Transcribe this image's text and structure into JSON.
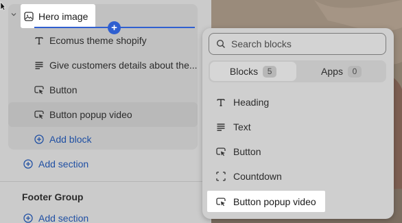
{
  "sidebar": {
    "section": {
      "title": "Hero image",
      "blocks": [
        {
          "label": "Ecomus theme shopify",
          "icon": "text-icon"
        },
        {
          "label": "Give customers details about the...",
          "icon": "paragraph-icon"
        },
        {
          "label": "Button",
          "icon": "button-cursor-icon"
        },
        {
          "label": "Button popup video",
          "icon": "button-cursor-icon"
        }
      ],
      "add_block": "Add block"
    },
    "add_section": "Add section",
    "footer_group": {
      "title": "Footer Group",
      "add_section": "Add section"
    }
  },
  "popover": {
    "search_placeholder": "Search blocks",
    "tabs": [
      {
        "label": "Blocks",
        "count": "5"
      },
      {
        "label": "Apps",
        "count": "0"
      }
    ],
    "blocks": [
      {
        "label": "Heading",
        "icon": "text-icon"
      },
      {
        "label": "Text",
        "icon": "paragraph-icon"
      },
      {
        "label": "Button",
        "icon": "button-cursor-icon"
      },
      {
        "label": "Countdown",
        "icon": "countdown-frame-icon"
      },
      {
        "label": "Button popup video",
        "icon": "button-cursor-icon"
      }
    ]
  },
  "colors": {
    "accent_blue": "#2f5fd0",
    "link_blue": "#1f4fa3"
  }
}
